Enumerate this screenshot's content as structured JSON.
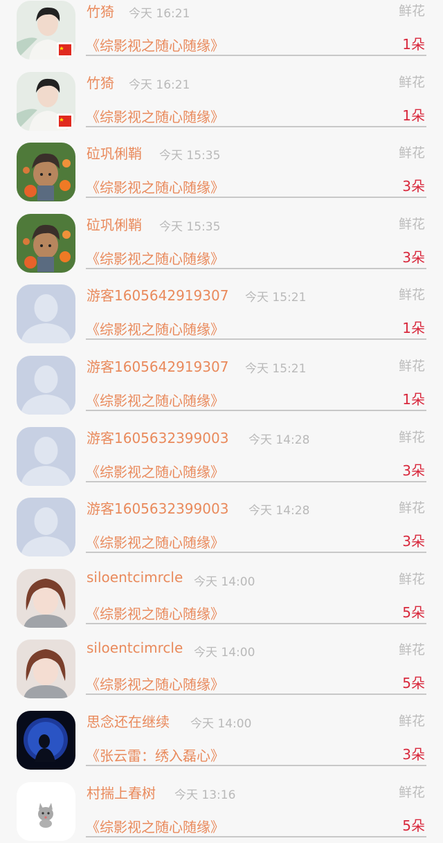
{
  "gift_label": "鲜花",
  "rows": [
    {
      "name": "竹猗",
      "time": "今天 16:21",
      "book": "《综影视之随心随缘》",
      "count": "1朵",
      "avatar": "man-flag"
    },
    {
      "name": "竹猗",
      "time": "今天 16:21",
      "book": "《综影视之随心随缘》",
      "count": "1朵",
      "avatar": "man-flag"
    },
    {
      "name": "砬巩俐鞘",
      "time": "今天 15:35",
      "book": "《综影视之随心随缘》",
      "count": "3朵",
      "avatar": "cartoon-flowers"
    },
    {
      "name": "砬巩俐鞘",
      "time": "今天 15:35",
      "book": "《综影视之随心随缘》",
      "count": "3朵",
      "avatar": "cartoon-flowers"
    },
    {
      "name": "游客1605642919307",
      "time": "今天 15:21",
      "book": "《综影视之随心随缘》",
      "count": "1朵",
      "avatar": "default-person"
    },
    {
      "name": "游客1605642919307",
      "time": "今天 15:21",
      "book": "《综影视之随心随缘》",
      "count": "1朵",
      "avatar": "default-person"
    },
    {
      "name": "游客1605632399003",
      "time": "今天 14:28",
      "book": "《综影视之随心随缘》",
      "count": "3朵",
      "avatar": "default-person"
    },
    {
      "name": "游客1605632399003",
      "time": "今天 14:28",
      "book": "《综影视之随心随缘》",
      "count": "3朵",
      "avatar": "default-person"
    },
    {
      "name": "siloentcimrcle",
      "time": "今天 14:00",
      "book": "《综影视之随心随缘》",
      "count": "5朵",
      "avatar": "girl-photo"
    },
    {
      "name": "siloentcimrcle",
      "time": "今天 14:00",
      "book": "《综影视之随心随缘》",
      "count": "5朵",
      "avatar": "girl-photo"
    },
    {
      "name": "思念还在继续",
      "time": "今天 14:00",
      "book": "《张云雷：绣入磊心》",
      "count": "3朵",
      "avatar": "dark-blue-silhouette"
    },
    {
      "name": "村揣上春树",
      "time": "今天 13:16",
      "book": "《综影视之随心随缘》",
      "count": "5朵",
      "avatar": "grey-cat"
    }
  ],
  "colors": {
    "name": "#e98a5c",
    "time": "#b9b9b9",
    "gift": "#bcbcbc",
    "count": "#d8283c",
    "background": "#f7f7f7"
  }
}
